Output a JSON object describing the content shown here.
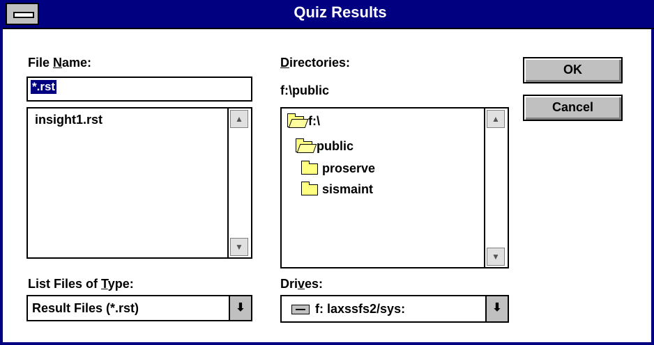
{
  "window": {
    "title": "Quiz Results"
  },
  "file_name": {
    "label_prefix": "File ",
    "label_mnemonic": "N",
    "label_suffix": "ame:",
    "value": "*.rst"
  },
  "files": {
    "items": [
      "insight1.rst"
    ]
  },
  "directories": {
    "label_mnemonic": "D",
    "label_suffix": "irectories:",
    "current_path": "f:\\public",
    "items": [
      {
        "label": "f:\\",
        "icon": "open-folder-icon"
      },
      {
        "label": "public",
        "icon": "open-folder-icon"
      },
      {
        "label": "proserve",
        "icon": "folder-icon"
      },
      {
        "label": "sismaint",
        "icon": "folder-icon"
      }
    ]
  },
  "buttons": {
    "ok": "OK",
    "cancel": "Cancel"
  },
  "file_type": {
    "label_prefix": "List Files of ",
    "label_mnemonic": "T",
    "label_suffix": "ype:",
    "value": "Result Files (*.rst)"
  },
  "drives": {
    "label_prefix": "Dri",
    "label_mnemonic": "v",
    "label_suffix": "es:",
    "value": "f: laxssfs2/sys:"
  },
  "icons": {
    "scroll_up": "▲",
    "scroll_down": "▼",
    "dropdown": "⬇"
  }
}
